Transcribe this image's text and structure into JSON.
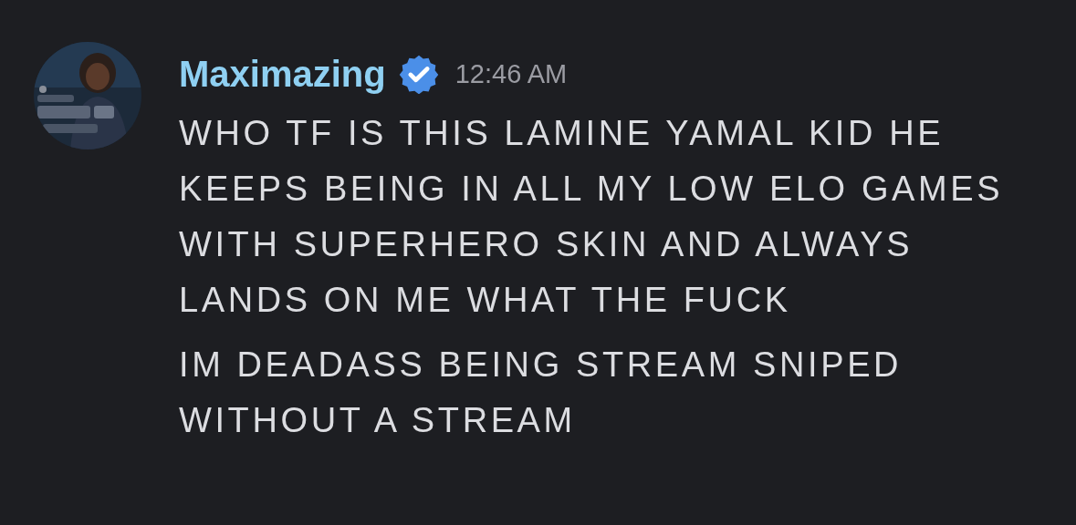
{
  "message": {
    "author": "Maximazing",
    "verified": true,
    "time": "12:46 AM",
    "paragraphs": [
      "WHO TF IS THIS LAMINE YAMAL KID HE KEEPS BEING IN ALL MY LOW ELO GAMES WITH SUPERHERO SKIN AND ALWAYS LANDS ON ME WHAT THE FUCK",
      "IM DEADASS BEING STREAM SNIPED WITHOUT A STREAM"
    ]
  }
}
